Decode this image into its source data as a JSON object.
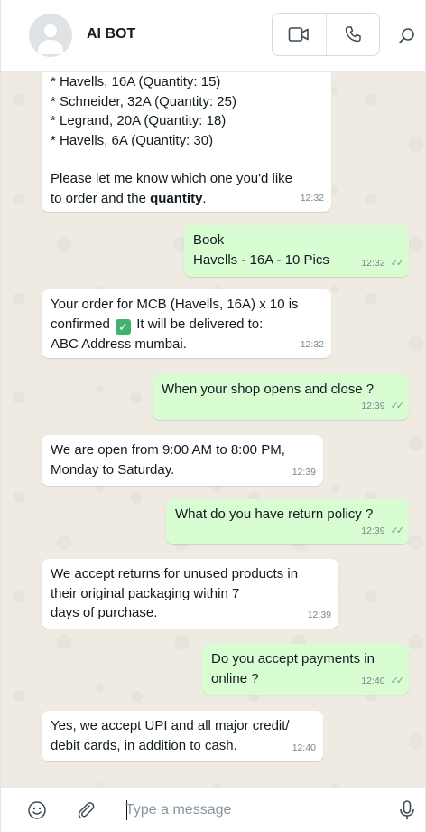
{
  "header": {
    "contact_name": "AI BOT",
    "icons": [
      "avatar",
      "video-call-icon",
      "voice-call-icon",
      "search-icon"
    ]
  },
  "messages": [
    {
      "direction": "incoming",
      "lines": [
        "* Havells, 16A (Quantity: 15)",
        "* Schneider, 32A (Quantity: 25)",
        "* Legrand, 20A (Quantity: 18)",
        "* Havells, 6A (Quantity: 30)"
      ],
      "line2_a": "Please let me know which one you'd like",
      "line2_b": "to order and the ",
      "line2_bold": "quantity",
      "line2_end": ".",
      "time": "12:32"
    },
    {
      "direction": "outgoing",
      "lines": [
        "Book",
        "Havells - 16A - 10 Pics"
      ],
      "time": "12:32"
    },
    {
      "direction": "incoming",
      "line1": "Your order for MCB (Havells, 16A) x 10 is",
      "line2_a": "confirmed",
      "line2_b": " It will be delivered to:",
      "line3": "ABC Address mumbai.",
      "time": "12:32"
    },
    {
      "direction": "outgoing",
      "text": "When your shop opens and close ?",
      "time": "12:39"
    },
    {
      "direction": "incoming",
      "lines": [
        "We are open from 9:00 AM to 8:00 PM,",
        "Monday to Saturday."
      ],
      "time": "12:39"
    },
    {
      "direction": "outgoing",
      "text": "What do you have return policy ?",
      "time": "12:39"
    },
    {
      "direction": "incoming",
      "lines": [
        "We accept returns for unused products in",
        "their original packaging within 7",
        "days of purchase."
      ],
      "time": "12:39"
    },
    {
      "direction": "outgoing",
      "lines": [
        "Do you accept payments in",
        "online ?"
      ],
      "time": "12:40"
    },
    {
      "direction": "incoming",
      "lines": [
        "Yes, we accept UPI and all major credit/",
        "debit cards, in addition to cash."
      ],
      "time": "12:40"
    }
  ],
  "composer": {
    "placeholder": "Type a message",
    "icons": [
      "emoji-icon",
      "attach-icon",
      "mic-icon"
    ]
  },
  "colors": {
    "incoming_bubble": "#ffffff",
    "outgoing_bubble": "#d9fdd3",
    "chat_background": "#efeae2"
  }
}
